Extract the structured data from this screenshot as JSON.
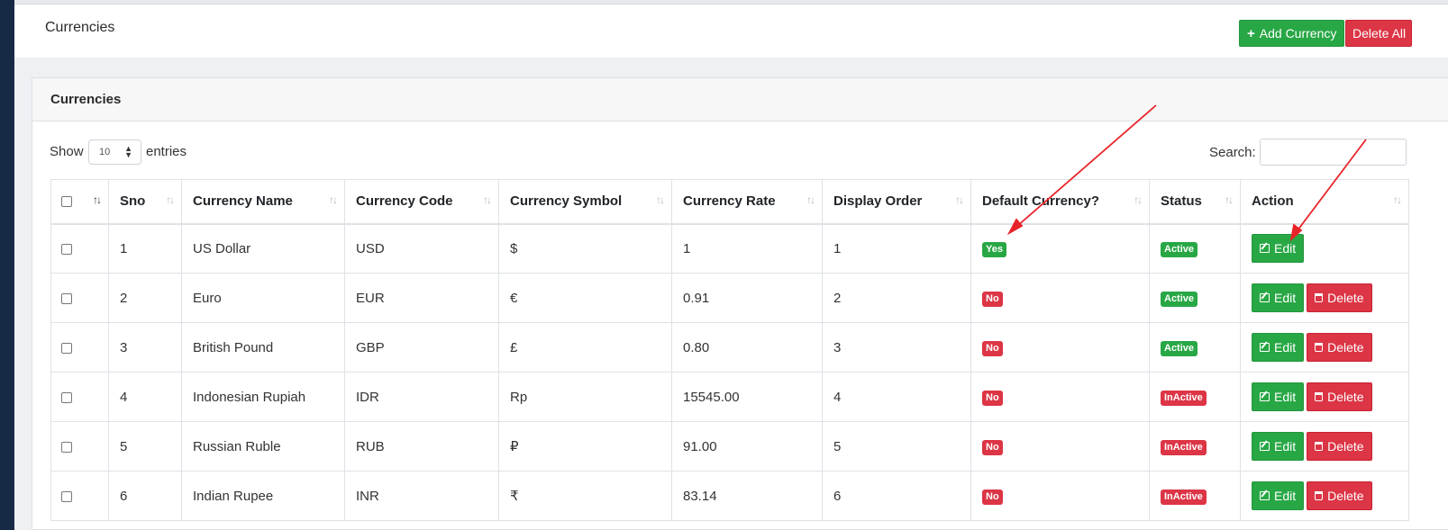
{
  "header": {
    "title": "Currencies",
    "add_button": "Add Currency",
    "add_icon": "plus-icon",
    "delete_all_button": "Delete All"
  },
  "card": {
    "title": "Currencies"
  },
  "controls": {
    "show_label": "Show",
    "entries_value": "10",
    "entries_label": "entries",
    "search_label": "Search:",
    "search_value": ""
  },
  "table": {
    "columns": [
      "Sno",
      "Currency Name",
      "Currency Code",
      "Currency Symbol",
      "Currency Rate",
      "Display Order",
      "Default Currency?",
      "Status",
      "Action"
    ],
    "rows": [
      {
        "sno": "1",
        "name": "US Dollar",
        "code": "USD",
        "symbol": "$",
        "rate": "1",
        "order": "1",
        "default": "Yes",
        "status": "Active",
        "has_delete": false
      },
      {
        "sno": "2",
        "name": "Euro",
        "code": "EUR",
        "symbol": "€",
        "rate": "0.91",
        "order": "2",
        "default": "No",
        "status": "Active",
        "has_delete": true
      },
      {
        "sno": "3",
        "name": "British Pound",
        "code": "GBP",
        "symbol": "£",
        "rate": "0.80",
        "order": "3",
        "default": "No",
        "status": "Active",
        "has_delete": true
      },
      {
        "sno": "4",
        "name": "Indonesian Rupiah",
        "code": "IDR",
        "symbol": "Rp",
        "rate": "15545.00",
        "order": "4",
        "default": "No",
        "status": "InActive",
        "has_delete": true
      },
      {
        "sno": "5",
        "name": "Russian Ruble",
        "code": "RUB",
        "symbol": "₽",
        "rate": "91.00",
        "order": "5",
        "default": "No",
        "status": "InActive",
        "has_delete": true
      },
      {
        "sno": "6",
        "name": "Indian Rupee",
        "code": "INR",
        "symbol": "₹",
        "rate": "83.14",
        "order": "6",
        "default": "No",
        "status": "InActive",
        "has_delete": true
      }
    ],
    "edit_label": "Edit",
    "delete_label": "Delete"
  },
  "colors": {
    "success": "#28a745",
    "danger": "#dc3545",
    "sidebar": "#172a45",
    "annotation_arrow": "#e8242a"
  }
}
